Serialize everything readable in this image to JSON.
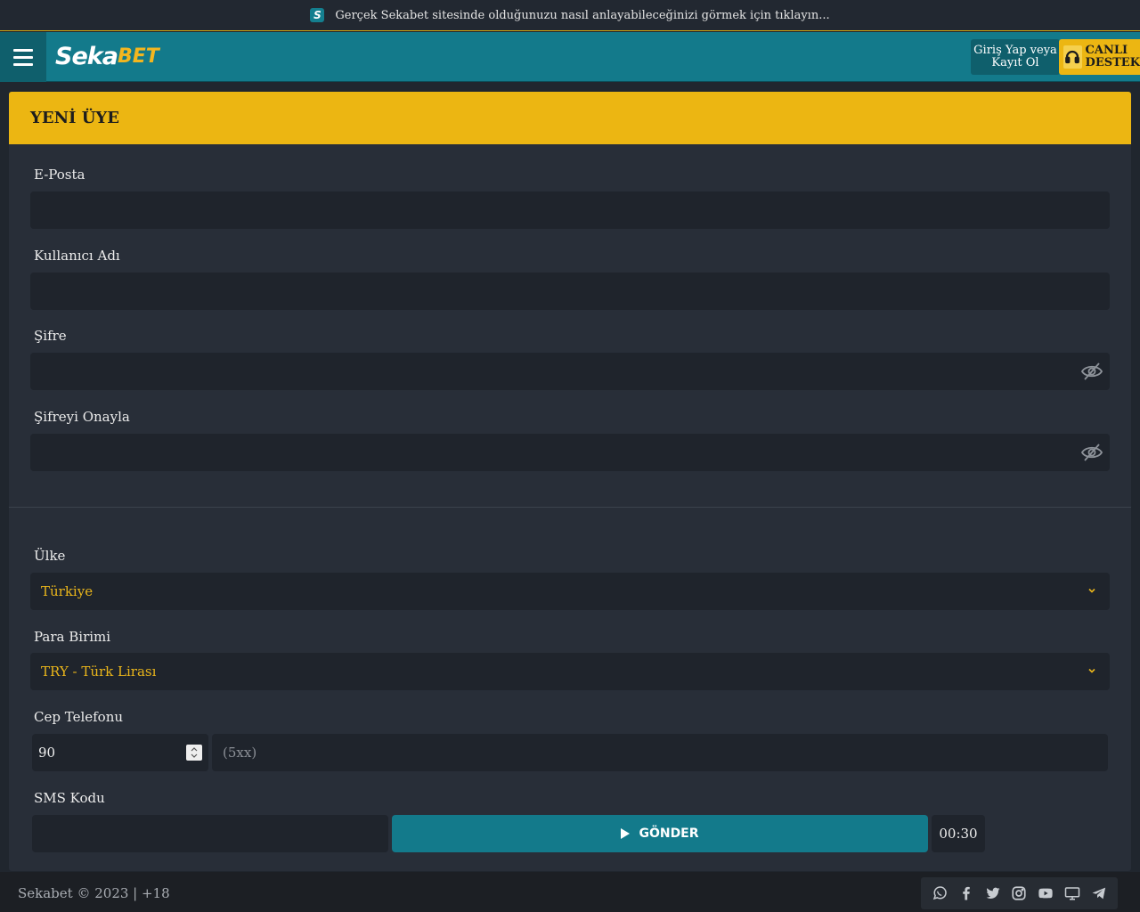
{
  "notice": {
    "logo_letter": "S",
    "text": "Gerçek Sekabet sitesinde olduğunuzu nasıl anlayabileceğinizi görmek için tıklayın..."
  },
  "header": {
    "logo_white": "Seka",
    "logo_yellow": "BET",
    "login_line1": "Giriş Yap veya",
    "login_line2": "Kayıt Ol",
    "support_line1": "CANLI",
    "support_line2": "DESTEK"
  },
  "form": {
    "title": "YENİ ÜYE",
    "email_label": "E-Posta",
    "username_label": "Kullanıcı Adı",
    "password_label": "Şifre",
    "confirm_label": "Şifreyi Onayla",
    "country_label": "Ülke",
    "country_value": "Türkiye",
    "currency_label": "Para Birimi",
    "currency_value": "TRY - Türk Lirası",
    "phone_label": "Cep Telefonu",
    "phone_code": "90",
    "phone_placeholder": "(5xx)",
    "sms_label": "SMS Kodu",
    "send_label": "GÖNDER",
    "timer": "00:30"
  },
  "footer": {
    "copyright": "Sekabet © 2023 | +18"
  },
  "colors": {
    "accent_yellow": "#ecb612",
    "teal": "#137a8b",
    "field_bg": "#1f242c",
    "panel_bg": "#282e38"
  },
  "icons": [
    "whatsapp-icon",
    "facebook-icon",
    "twitter-icon",
    "instagram-icon",
    "youtube-icon",
    "desktop-icon",
    "telegram-icon"
  ]
}
